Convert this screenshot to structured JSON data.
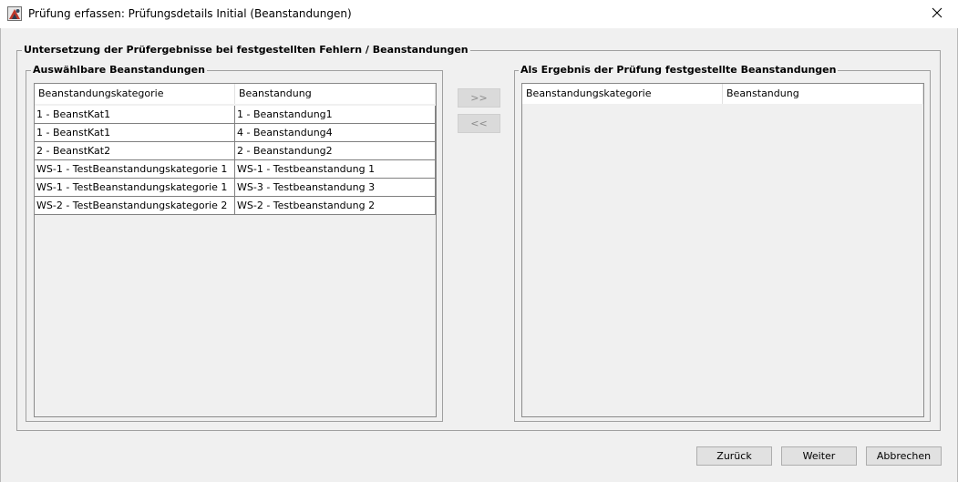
{
  "window": {
    "title": "Prüfung erfassen: Prüfungsdetails Initial (Beanstandungen)"
  },
  "main_group": {
    "legend": "Untersetzung der Prüfergebnisse bei festgestellten Fehlern / Beanstandungen"
  },
  "available": {
    "legend": "Auswählbare Beanstandungen",
    "headers": [
      "Beanstandungskategorie",
      "Beanstandung"
    ],
    "rows": [
      [
        "1 - BeanstKat1",
        "1 - Beanstandung1"
      ],
      [
        "1 - BeanstKat1",
        "4 - Beanstandung4"
      ],
      [
        "2 - BeanstKat2",
        "2 - Beanstandung2"
      ],
      [
        "WS-1 - TestBeanstandungskategorie 1",
        "WS-1 - Testbeanstandung 1"
      ],
      [
        "WS-1 - TestBeanstandungskategorie 1",
        "WS-3 - Testbeanstandung 3"
      ],
      [
        "WS-2 - TestBeanstandungskategorie 2",
        "WS-2 - Testbeanstandung 2"
      ]
    ]
  },
  "transfer": {
    "add_label": ">>",
    "remove_label": "<<"
  },
  "selected": {
    "legend": "Als Ergebnis der Prüfung festgestellte Beanstandungen",
    "headers": [
      "Beanstandungskategorie",
      "Beanstandung"
    ],
    "rows": []
  },
  "footer": {
    "back_label": "Zurück",
    "next_label": "Weiter",
    "cancel_label": "Abbrechen"
  }
}
